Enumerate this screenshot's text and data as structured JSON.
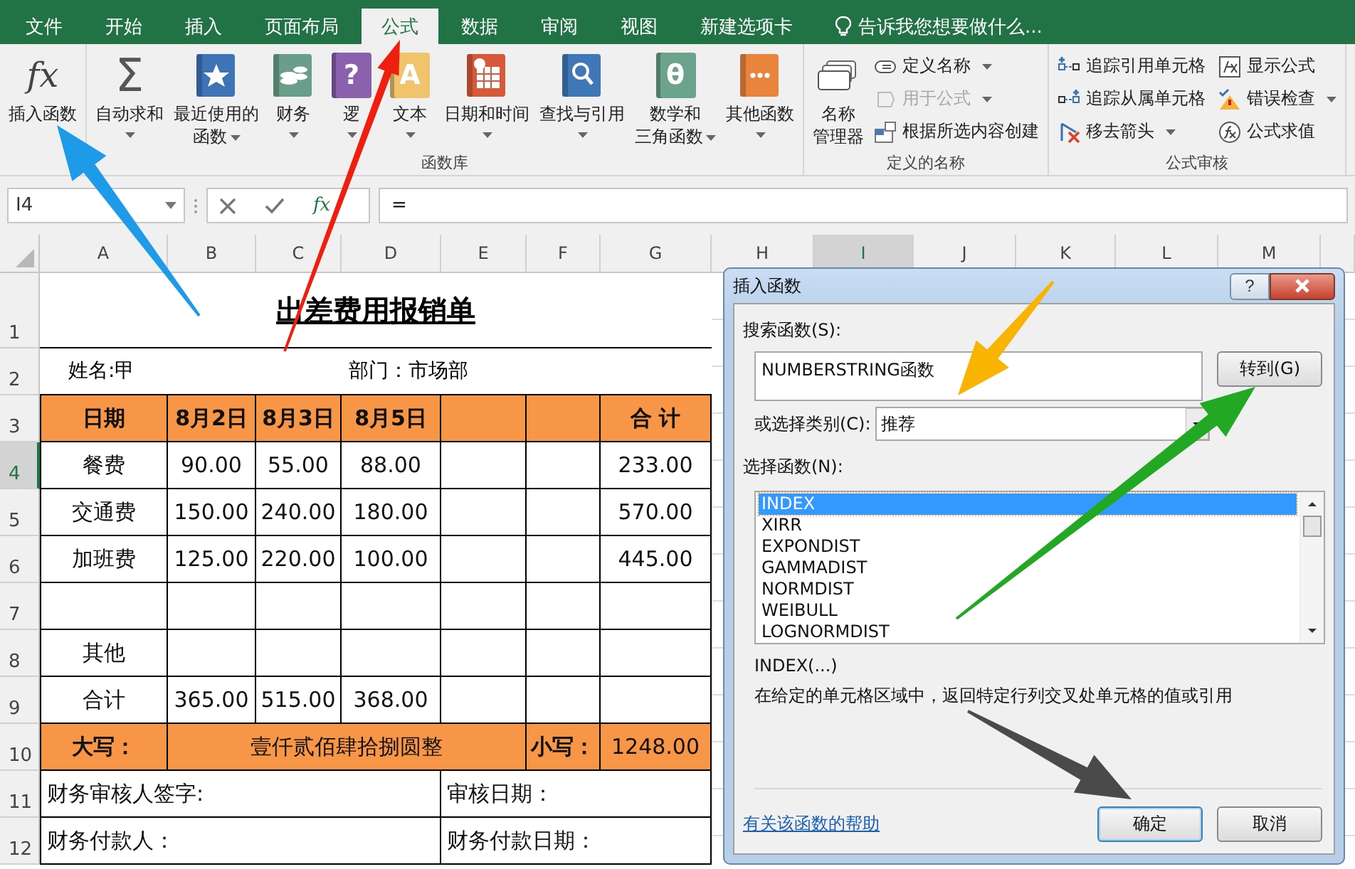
{
  "ribbon_tabs": [
    {
      "label": "文件",
      "selected": false
    },
    {
      "label": "开始",
      "selected": false
    },
    {
      "label": "插入",
      "selected": false
    },
    {
      "label": "页面布局",
      "selected": false
    },
    {
      "label": "公式",
      "selected": true
    },
    {
      "label": "数据",
      "selected": false
    },
    {
      "label": "审阅",
      "selected": false
    },
    {
      "label": "视图",
      "selected": false
    },
    {
      "label": "新建选项卡",
      "selected": false
    }
  ],
  "tell_me": {
    "placeholder": "告诉我您想要做什么..."
  },
  "ribbon_groups": [
    {
      "large_buttons": [
        {
          "lines": [
            "插入函数"
          ],
          "glyph": "fx",
          "dropdown": false
        }
      ]
    },
    {
      "label": "函数库",
      "large_buttons": [
        {
          "lines": [
            "自动求和"
          ],
          "glyph": "Σ",
          "dropdown": true
        },
        {
          "lines": [
            "最近使用的",
            "函数"
          ],
          "dropdown": true
        },
        {
          "lines": [
            "财务"
          ],
          "dropdown": true
        },
        {
          "lines": [
            "逻"
          ],
          "glyph": "?",
          "dropdown": true
        },
        {
          "lines": [
            "文本"
          ],
          "glyph": "A",
          "dropdown": true
        },
        {
          "lines": [
            "日期和时间"
          ],
          "dropdown": true
        },
        {
          "lines": [
            "查找与引用"
          ],
          "dropdown": true
        },
        {
          "lines": [
            "数学和",
            "三角函数"
          ],
          "glyph": "θ",
          "dropdown": true
        },
        {
          "lines": [
            "其他函数"
          ],
          "dropdown": true
        }
      ]
    },
    {
      "label": "定义的名称",
      "large_buttons": [
        {
          "lines": [
            "名称",
            "管理器"
          ],
          "dropdown": false
        }
      ],
      "small_buttons": [
        {
          "label": "定义名称",
          "dropdown": true,
          "disabled": false
        },
        {
          "label": "用于公式",
          "dropdown": true,
          "disabled": true
        },
        {
          "label": "根据所选内容创建",
          "dropdown": false,
          "disabled": false
        }
      ]
    },
    {
      "label": "公式审核",
      "small_buttons": [
        {
          "label": "追踪引用单元格",
          "dropdown": false,
          "disabled": false
        },
        {
          "label": "追踪从属单元格",
          "dropdown": false,
          "disabled": false
        },
        {
          "label": "移去箭头",
          "dropdown": true,
          "disabled": false
        },
        {
          "label": "显示公式",
          "dropdown": false,
          "disabled": false
        },
        {
          "label": "错误检查",
          "dropdown": true,
          "disabled": false
        },
        {
          "label": "公式求值",
          "dropdown": false,
          "disabled": false
        }
      ]
    }
  ],
  "formula_bar": {
    "name_box": "I4",
    "fx_glyph": "fx",
    "formula": "="
  },
  "columns": [
    {
      "label": "A",
      "selected": false
    },
    {
      "label": "B",
      "selected": false
    },
    {
      "label": "C",
      "selected": false
    },
    {
      "label": "D",
      "selected": false
    },
    {
      "label": "E",
      "selected": false
    },
    {
      "label": "F",
      "selected": false
    },
    {
      "label": "G",
      "selected": false
    },
    {
      "label": "H",
      "selected": false
    },
    {
      "label": "I",
      "selected": true
    },
    {
      "label": "J",
      "selected": false
    },
    {
      "label": "K",
      "selected": false
    },
    {
      "label": "L",
      "selected": false
    },
    {
      "label": "M",
      "selected": false
    }
  ],
  "rows": [
    {
      "label": "1",
      "selected": false
    },
    {
      "label": "2",
      "selected": false
    },
    {
      "label": "3",
      "selected": false
    },
    {
      "label": "4",
      "selected": true
    },
    {
      "label": "5",
      "selected": false
    },
    {
      "label": "6",
      "selected": false
    },
    {
      "label": "7",
      "selected": false
    },
    {
      "label": "8",
      "selected": false
    },
    {
      "label": "9",
      "selected": false
    },
    {
      "label": "10",
      "selected": false
    },
    {
      "label": "11",
      "selected": false
    },
    {
      "label": "12",
      "selected": false
    }
  ],
  "sheet": {
    "title": "出差费用报销单",
    "name": "姓名:甲",
    "department": "部门：市场部",
    "header": {
      "label": "日期",
      "dates": [
        "8月2日",
        "8月3日",
        "8月5日"
      ],
      "total": "合 计"
    },
    "lines": [
      {
        "kind": "item",
        "label": "餐费",
        "values": [
          "90.00",
          "55.00",
          "88.00"
        ],
        "total": "233.00"
      },
      {
        "kind": "item",
        "label": "交通费",
        "values": [
          "150.00",
          "240.00",
          "180.00"
        ],
        "total": "570.00"
      },
      {
        "kind": "item",
        "label": "加班费",
        "values": [
          "125.00",
          "220.00",
          "100.00"
        ],
        "total": "445.00"
      },
      {
        "kind": "blank"
      },
      {
        "kind": "item",
        "label": "其他"
      },
      {
        "kind": "item",
        "label": "合计",
        "values": [
          "365.00",
          "515.00",
          "368.00"
        ]
      }
    ],
    "capital_label": "大写：",
    "capital_amount": "壹仟贰佰肆拾捌圆整",
    "small_label": "小写：",
    "small_amount": "1248.00",
    "signoffs": [
      "财务审核人签字:",
      "审核日期：",
      "财务付款人：",
      "财务付款日期："
    ]
  },
  "dialog": {
    "title": "插入函数",
    "help_glyph": "?",
    "search_label": "搜索函数(S):",
    "search_value": "NUMBERSTRING函数",
    "go_button": "转到(G)",
    "category_label": "或选择类别(C):",
    "category_value": "推荐",
    "list_label": "选择函数(N):",
    "functions": [
      {
        "name": "INDEX",
        "selected": true
      },
      {
        "name": "XIRR",
        "selected": false
      },
      {
        "name": "EXPONDIST",
        "selected": false
      },
      {
        "name": "GAMMADIST",
        "selected": false
      },
      {
        "name": "NORMDIST",
        "selected": false
      },
      {
        "name": "WEIBULL",
        "selected": false
      },
      {
        "name": "LOGNORMDIST",
        "selected": false
      }
    ],
    "signature": "INDEX(...)",
    "description": "在给定的单元格区域中，返回特定行列交叉处单元格的值或引用",
    "help_link": "有关该函数的帮助",
    "ok_button": "确定",
    "cancel_button": "取消"
  }
}
